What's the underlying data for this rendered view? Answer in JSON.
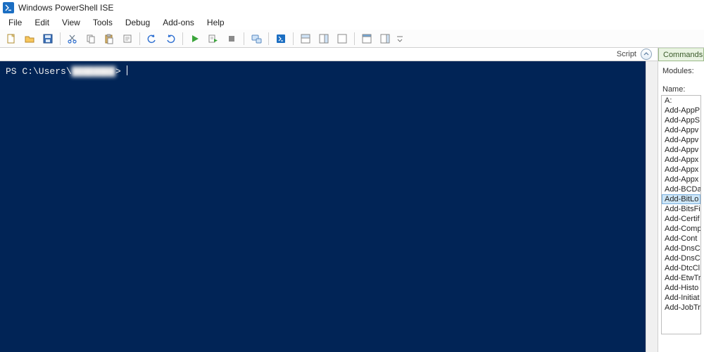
{
  "title": "Windows PowerShell ISE",
  "menu": [
    "File",
    "Edit",
    "View",
    "Tools",
    "Debug",
    "Add-ons",
    "Help"
  ],
  "toolbar": {
    "new": "New",
    "open": "Open",
    "save": "Save",
    "cut": "Cut",
    "copy": "Copy",
    "paste": "Paste",
    "clear": "Clear",
    "undo": "Undo",
    "redo": "Redo",
    "run": "Run Script",
    "run_selection": "Run Selection",
    "stop": "Stop",
    "remote": "New Remote PowerShell Tab",
    "start_ps": "Start PowerShell.exe",
    "layout_both": "Show Script Pane Top",
    "layout_right": "Show Script Pane Right",
    "layout_max": "Show Script Pane Maximized",
    "show_cmd": "Show Command Window",
    "show_addon": "Show Command Add-on",
    "overflow": "Toolbar Options"
  },
  "pane": {
    "tab_label": "Script",
    "collapse_tip": "Hide Script Pane"
  },
  "console": {
    "prompt_prefix": "PS C:\\Users\\",
    "prompt_user_masked": "████████",
    "prompt_suffix": "> "
  },
  "commands_panel": {
    "tab": "Commands",
    "modules_label": "Modules:",
    "name_label": "Name:",
    "items": [
      {
        "label": "A:",
        "selected": false
      },
      {
        "label": "Add-AppP",
        "selected": false
      },
      {
        "label": "Add-AppS",
        "selected": false
      },
      {
        "label": "Add-Appv",
        "selected": false
      },
      {
        "label": "Add-Appv",
        "selected": false
      },
      {
        "label": "Add-Appv",
        "selected": false
      },
      {
        "label": "Add-Appx",
        "selected": false
      },
      {
        "label": "Add-Appx",
        "selected": false
      },
      {
        "label": "Add-Appx",
        "selected": false
      },
      {
        "label": "Add-BCDa",
        "selected": false
      },
      {
        "label": "Add-BitLo",
        "selected": true
      },
      {
        "label": "Add-BitsFi",
        "selected": false
      },
      {
        "label": "Add-Certif",
        "selected": false
      },
      {
        "label": "Add-Comp",
        "selected": false
      },
      {
        "label": "Add-Cont",
        "selected": false
      },
      {
        "label": "Add-DnsC",
        "selected": false
      },
      {
        "label": "Add-DnsC",
        "selected": false
      },
      {
        "label": "Add-DtcCl",
        "selected": false
      },
      {
        "label": "Add-EtwTr",
        "selected": false
      },
      {
        "label": "Add-Histo",
        "selected": false
      },
      {
        "label": "Add-Initiat",
        "selected": false
      },
      {
        "label": "Add-JobTr",
        "selected": false
      }
    ]
  }
}
